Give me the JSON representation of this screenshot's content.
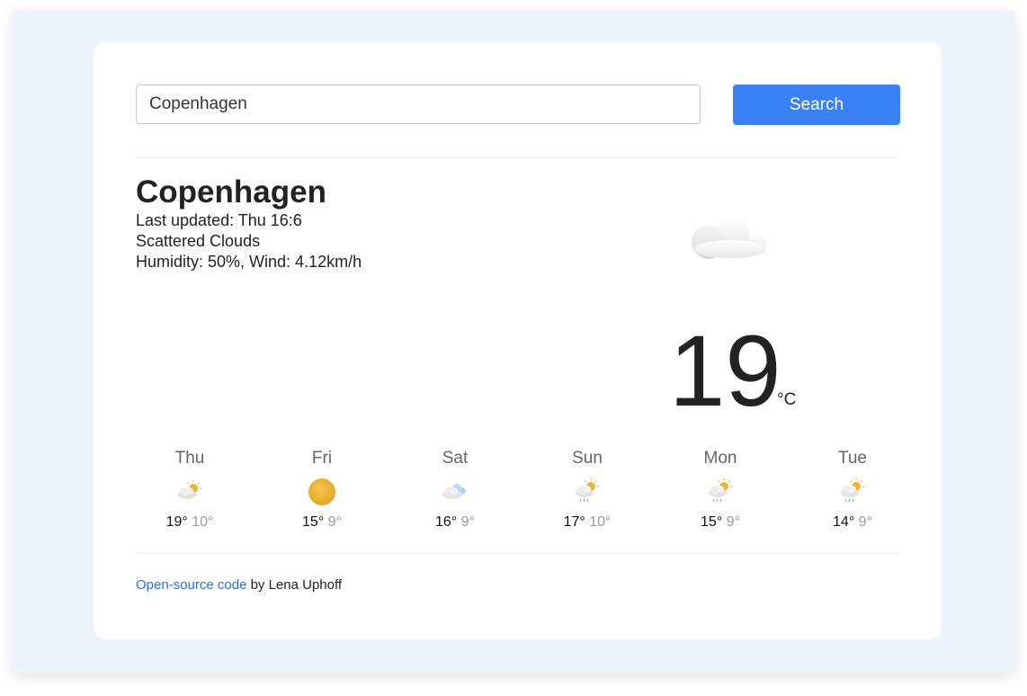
{
  "search": {
    "value": "Copenhagen",
    "button_label": "Search"
  },
  "current": {
    "city": "Copenhagen",
    "last_updated": "Last updated: Thu 16:6",
    "description": "Scattered Clouds",
    "details": "Humidity: 50%, Wind: 4.12km/h",
    "temperature": "19",
    "unit": "°C",
    "icon": "cloud-icon"
  },
  "forecast": [
    {
      "day": "Thu",
      "max": "19°",
      "min": "10°",
      "icon": "partly-cloudy-icon"
    },
    {
      "day": "Fri",
      "max": "15°",
      "min": "9°",
      "icon": "sun-icon"
    },
    {
      "day": "Sat",
      "max": "16°",
      "min": "9°",
      "icon": "cloudy-icon"
    },
    {
      "day": "Sun",
      "max": "17°",
      "min": "10°",
      "icon": "sun-rain-icon"
    },
    {
      "day": "Mon",
      "max": "15°",
      "min": "9°",
      "icon": "sun-rain-icon"
    },
    {
      "day": "Tue",
      "max": "14°",
      "min": "9°",
      "icon": "sun-rain-icon"
    }
  ],
  "footer": {
    "link_text": "Open-source code",
    "by_text": " by Lena Uphoff"
  },
  "colors": {
    "accent": "#3a80f6",
    "link": "#2c6ed8",
    "backdrop": "#edf4fd",
    "sun": "#f0b530"
  }
}
